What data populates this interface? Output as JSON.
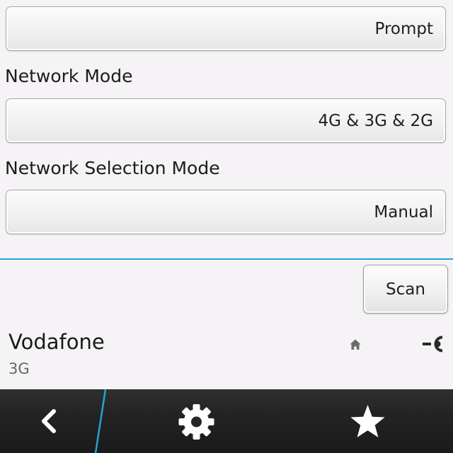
{
  "settings": {
    "top_dropdown_value": "Prompt",
    "network_mode": {
      "label": "Network Mode",
      "value": "4G & 3G & 2G"
    },
    "network_selection_mode": {
      "label": "Network Selection Mode",
      "value": "Manual"
    }
  },
  "scan": {
    "label": "Scan"
  },
  "networks": [
    {
      "name": "Vodafone",
      "technology": "3G",
      "icons": [
        "home-icon",
        "connected-icon"
      ]
    }
  ],
  "action_bar": {
    "icons": [
      "back-chevron-icon",
      "gear-icon",
      "star-icon"
    ]
  },
  "colors": {
    "accent": "#1fa5d4",
    "background": "#f5f3f5",
    "action_bar": "#232323"
  }
}
